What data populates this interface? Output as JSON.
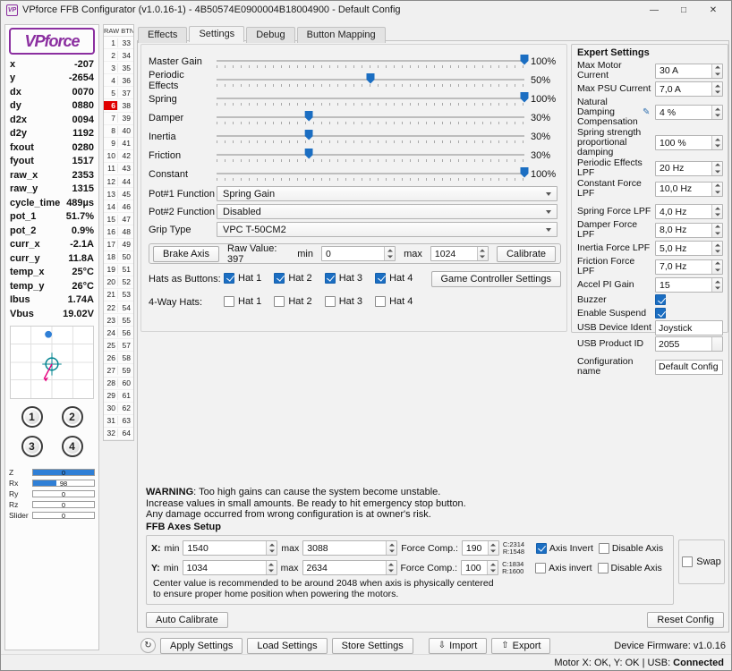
{
  "colors": {
    "accent_blue": "#1b6ec2",
    "highlight_red": "#e00000",
    "logo_purple": "#8b2fa0"
  },
  "window": {
    "title": "VPforce FFB Configurator (v1.0.16-1) - 4B50574E0900004B18004900 - Default Config",
    "app_icon": "VP",
    "controls": {
      "minimize": "—",
      "maximize": "□",
      "close": "✕"
    }
  },
  "left_panel": {
    "logo_text": "VPforce",
    "telemetry": [
      {
        "label": "x",
        "value": "-207"
      },
      {
        "label": "y",
        "value": "-2654"
      },
      {
        "label": "dx",
        "value": "0070"
      },
      {
        "label": "dy",
        "value": "0880"
      },
      {
        "label": "d2x",
        "value": "0094"
      },
      {
        "label": "d2y",
        "value": "1192"
      },
      {
        "label": "fxout",
        "value": "0280"
      },
      {
        "label": "fyout",
        "value": "1517"
      },
      {
        "label": "raw_x",
        "value": "2353"
      },
      {
        "label": "raw_y",
        "value": "1315"
      },
      {
        "label": "cycle_time",
        "value": "489µs"
      },
      {
        "label": "pot_1",
        "value": "51.7%"
      },
      {
        "label": "pot_2",
        "value": "0.9%"
      },
      {
        "label": "curr_x",
        "value": "-2.1A"
      },
      {
        "label": "curr_y",
        "value": "11.8A"
      },
      {
        "label": "temp_x",
        "value": "25°C"
      },
      {
        "label": "temp_y",
        "value": "26°C"
      },
      {
        "label": "Ibus",
        "value": "1.74A"
      },
      {
        "label": "Vbus",
        "value": "19.02V"
      }
    ],
    "joy_buttons": [
      "1",
      "2",
      "3",
      "4"
    ],
    "axes": [
      {
        "label": "Z",
        "value": "0",
        "fill_pct": 100
      },
      {
        "label": "Rx",
        "value": "98",
        "fill_pct": 38
      },
      {
        "label": "Ry",
        "value": "0",
        "fill_pct": 0
      },
      {
        "label": "Rz",
        "value": "0",
        "fill_pct": 0
      },
      {
        "label": "Slider",
        "value": "0",
        "fill_pct": 0
      }
    ]
  },
  "raw_btn": {
    "header": "RAW BTN",
    "rows": [
      {
        "n": "1",
        "v": "33"
      },
      {
        "n": "2",
        "v": "34"
      },
      {
        "n": "3",
        "v": "35"
      },
      {
        "n": "4",
        "v": "36"
      },
      {
        "n": "5",
        "v": "37"
      },
      {
        "n": "6",
        "v": "38",
        "hl": true
      },
      {
        "n": "7",
        "v": "39"
      },
      {
        "n": "8",
        "v": "40"
      },
      {
        "n": "9",
        "v": "41"
      },
      {
        "n": "10",
        "v": "42"
      },
      {
        "n": "11",
        "v": "43"
      },
      {
        "n": "12",
        "v": "44"
      },
      {
        "n": "13",
        "v": "45"
      },
      {
        "n": "14",
        "v": "46"
      },
      {
        "n": "15",
        "v": "47"
      },
      {
        "n": "16",
        "v": "48"
      },
      {
        "n": "17",
        "v": "49"
      },
      {
        "n": "18",
        "v": "50"
      },
      {
        "n": "19",
        "v": "51"
      },
      {
        "n": "20",
        "v": "52"
      },
      {
        "n": "21",
        "v": "53"
      },
      {
        "n": "22",
        "v": "54"
      },
      {
        "n": "23",
        "v": "55"
      },
      {
        "n": "24",
        "v": "56"
      },
      {
        "n": "25",
        "v": "57"
      },
      {
        "n": "26",
        "v": "58"
      },
      {
        "n": "27",
        "v": "59"
      },
      {
        "n": "28",
        "v": "60"
      },
      {
        "n": "29",
        "v": "61"
      },
      {
        "n": "30",
        "v": "62"
      },
      {
        "n": "31",
        "v": "63"
      },
      {
        "n": "32",
        "v": "64"
      }
    ]
  },
  "tabs": [
    {
      "label": "Effects",
      "active": false
    },
    {
      "label": "Settings",
      "active": true
    },
    {
      "label": "Debug",
      "active": false
    },
    {
      "label": "Button Mapping",
      "active": false
    }
  ],
  "settings": {
    "sliders": [
      {
        "label": "Master Gain",
        "value": "100%",
        "pct": 100
      },
      {
        "label": "Periodic Effects",
        "value": "50%",
        "pct": 50
      },
      {
        "label": "Spring",
        "value": "100%",
        "pct": 100
      },
      {
        "label": "Damper",
        "value": "30%",
        "pct": 30
      },
      {
        "label": "Inertia",
        "value": "30%",
        "pct": 30
      },
      {
        "label": "Friction",
        "value": "30%",
        "pct": 30
      },
      {
        "label": "Constant",
        "value": "100%",
        "pct": 100
      }
    ],
    "combos": [
      {
        "label": "Pot#1 Function",
        "value": "Spring Gain"
      },
      {
        "label": "Pot#2 Function",
        "value": "Disabled"
      },
      {
        "label": "Grip Type",
        "value": "VPC T-50CM2"
      }
    ],
    "brake": {
      "button": "Brake Axis",
      "raw_value": "Raw Value: 397",
      "min_label": "min",
      "min_value": "0",
      "max_label": "max",
      "max_value": "1024",
      "calibrate": "Calibrate"
    },
    "hats_as_buttons": {
      "label": "Hats as Buttons:",
      "items": [
        {
          "label": "Hat 1",
          "checked": true
        },
        {
          "label": "Hat 2",
          "checked": true
        },
        {
          "label": "Hat 3",
          "checked": true
        },
        {
          "label": "Hat 4",
          "checked": true
        }
      ],
      "game_controller_button": "Game Controller Settings"
    },
    "four_way_hats": {
      "label": "4-Way Hats:",
      "items": [
        {
          "label": "Hat 1",
          "checked": false
        },
        {
          "label": "Hat 2",
          "checked": false
        },
        {
          "label": "Hat 3",
          "checked": false
        },
        {
          "label": "Hat 4",
          "checked": false
        }
      ]
    }
  },
  "expert": {
    "title": "Expert Settings",
    "edit_icon": "✎",
    "spin_rows": [
      {
        "label": "Max Motor Current",
        "value": "30 A"
      },
      {
        "label": "Max PSU Current",
        "value": "7,0 A"
      },
      {
        "label": "Natural Damping Compensation",
        "value": "4 %",
        "icon": true
      },
      {
        "label": "Spring strength proportional damping",
        "value": "100 %"
      },
      {
        "label": "Periodic Effects LPF",
        "value": "20 Hz"
      },
      {
        "label": "Constant Force LPF",
        "value": "10,0 Hz"
      },
      {
        "label": "Spring Force LPF",
        "value": "4,0 Hz",
        "gap": true
      },
      {
        "label": "Damper Force LPF",
        "value": "8,0 Hz"
      },
      {
        "label": "Inertia Force LPF",
        "value": "5,0 Hz"
      },
      {
        "label": "Friction Force LPF",
        "value": "7,0 Hz"
      },
      {
        "label": "Accel PI Gain",
        "value": "15"
      }
    ],
    "check_rows": [
      {
        "label": "Buzzer",
        "checked": true
      },
      {
        "label": "Enable Suspend",
        "checked": true
      }
    ],
    "field_rows": [
      {
        "label": "USB Device Ident",
        "value": "Joystick",
        "spin": false
      },
      {
        "label": "USB Product ID",
        "value": "2055",
        "spin": true
      },
      {
        "label": "Configuration name",
        "value": "Default Config",
        "spin": false,
        "cfg": true
      }
    ]
  },
  "warning": {
    "bold": "WARNING",
    "line1": ": Too high gains can cause the system become unstable.",
    "line2": "Increase values in small amounts. Be ready to hit emergency stop button.",
    "line3": "Any damage occurred from wrong configuration is at owner's risk."
  },
  "ffb_axes": {
    "title": "FFB Axes Setup",
    "rows": [
      {
        "axis": "X:",
        "min_label": "min",
        "min": "1540",
        "max_label": "max",
        "max": "3088",
        "fc_label": "Force Comp.:",
        "fc": "190",
        "c": "C:2314",
        "r": "R:1548",
        "invert_label": "Axis Invert",
        "invert_checked": true,
        "disable_label": "Disable Axis",
        "disable_checked": false
      },
      {
        "axis": "Y:",
        "min_label": "min",
        "min": "1034",
        "max_label": "max",
        "max": "2634",
        "fc_label": "Force Comp.:",
        "fc": "100",
        "c": "C:1834",
        "r": "R:1600",
        "invert_label": "Axis invert",
        "invert_checked": false,
        "disable_label": "Disable Axis",
        "disable_checked": false
      }
    ],
    "note_line1": "Center value is recommended to be around 2048 when axis is physically centered",
    "note_line2": "to ensure proper home position when powering the motors.",
    "swap_label": "Swap",
    "swap_checked": false
  },
  "footer": {
    "auto_calibrate": "Auto Calibrate",
    "reset_config": "Reset Config",
    "refresh_icon": "↻",
    "apply": "Apply Settings",
    "load": "Load Settings",
    "store": "Store Settings",
    "import_icon": "⇩",
    "import": "Import",
    "export_icon": "⇧",
    "export": "Export",
    "firmware": "Device Firmware: v1.0.16"
  },
  "statusbar": {
    "text": "Motor X: OK, Y: OK | USB:",
    "status": "Connected"
  }
}
